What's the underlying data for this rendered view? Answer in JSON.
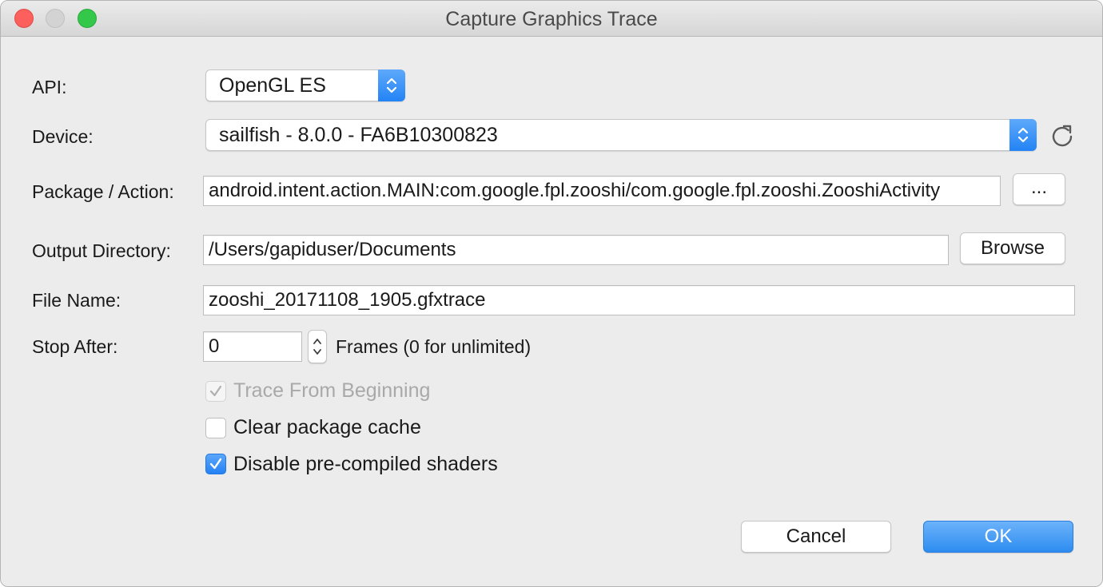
{
  "window": {
    "title": "Capture Graphics Trace"
  },
  "form": {
    "api": {
      "label": "API:",
      "value": "OpenGL ES"
    },
    "device": {
      "label": "Device:",
      "value": "sailfish - 8.0.0 - FA6B10300823"
    },
    "package": {
      "label": "Package / Action:",
      "value": "android.intent.action.MAIN:com.google.fpl.zooshi/com.google.fpl.zooshi.ZooshiActivity",
      "browse_label": "..."
    },
    "output_dir": {
      "label": "Output Directory:",
      "value": "/Users/gapiduser/Documents",
      "browse_label": "Browse"
    },
    "file_name": {
      "label": "File Name:",
      "value": "zooshi_20171108_1905.gfxtrace"
    },
    "stop_after": {
      "label": "Stop After:",
      "value": "0",
      "suffix": "Frames (0 for unlimited)"
    },
    "checkboxes": [
      {
        "label": "Trace From Beginning",
        "checked": true,
        "disabled": true
      },
      {
        "label": "Clear package cache",
        "checked": false,
        "disabled": false
      },
      {
        "label": "Disable pre-compiled shaders",
        "checked": true,
        "disabled": false
      }
    ]
  },
  "buttons": {
    "cancel": "Cancel",
    "ok": "OK"
  },
  "icons": {
    "close": "close-icon",
    "minimize": "minimize-icon",
    "zoom": "zoom-icon",
    "refresh": "refresh-icon",
    "checkmark": "checkmark-icon",
    "popup_arrows": "chevron-updown-icon"
  },
  "colors": {
    "accent": "#2d8cf0",
    "close": "#fc605c",
    "zoom": "#34c84a"
  }
}
